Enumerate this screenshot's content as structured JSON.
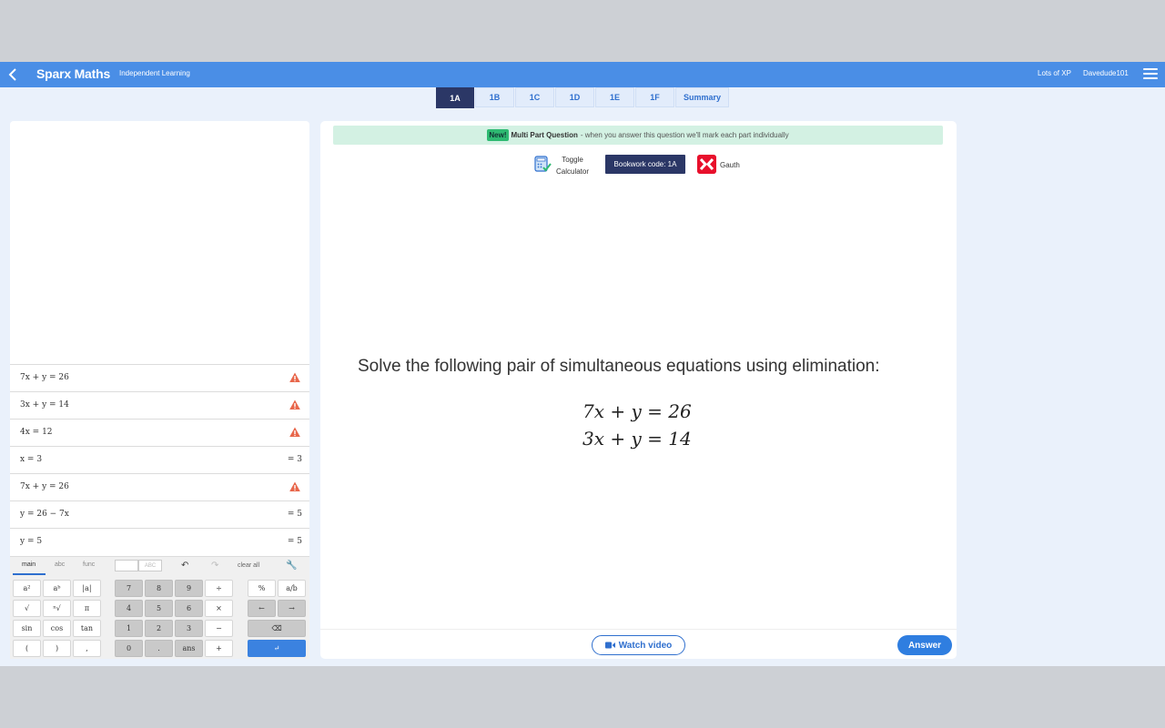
{
  "topbar": {
    "brand": "Sparx Maths",
    "subtitle": "Independent Learning",
    "xp": "Lots of XP",
    "user": "Davedude101"
  },
  "tabs": [
    "1A",
    "1B",
    "1C",
    "1D",
    "1E",
    "1F",
    "Summary"
  ],
  "calculator": {
    "history": [
      {
        "expr": "7x + y = 26",
        "result": "",
        "warning": true
      },
      {
        "expr": "3x + y = 14",
        "result": "",
        "warning": true
      },
      {
        "expr": "4x = 12",
        "result": "",
        "warning": true
      },
      {
        "expr": "x = 3",
        "result": "= 3",
        "warning": false
      },
      {
        "expr": "7x + y = 26",
        "result": "",
        "warning": true
      },
      {
        "expr": "y = 26 − 7x",
        "result": "= 5",
        "warning": false
      },
      {
        "expr": "y = 5",
        "result": "= 5",
        "warning": false
      }
    ],
    "keyboard_tabs": [
      "main",
      "abc",
      "func"
    ],
    "abc_placeholder": "ABC",
    "clear_all": "clear all",
    "keys": {
      "r1": [
        "a²",
        "aᵇ",
        "|a|",
        "7",
        "8",
        "9",
        "÷",
        "%",
        "a/b"
      ],
      "r2": [
        "√",
        "ⁿ√",
        "π",
        "4",
        "5",
        "6",
        "×",
        "←",
        "→"
      ],
      "r3": [
        "sin",
        "cos",
        "tan",
        "1",
        "2",
        "3",
        "−",
        "⌫"
      ],
      "r4": [
        "(",
        ")",
        ",",
        "0",
        ".",
        "ans",
        "+",
        "↵"
      ]
    }
  },
  "main": {
    "banner_badge": "New!",
    "banner_title": "Multi Part Question",
    "banner_text": "- when you answer this question we'll mark each part individually",
    "toggle_line1": "Toggle",
    "toggle_line2": "Calculator",
    "bookwork": "Bookwork code: 1A",
    "gauth": "Gauth",
    "question": "Solve the following pair of simultaneous equations using elimination:",
    "equations": [
      "7x + y = 26",
      "3x + y = 14"
    ],
    "watch_video": "Watch video",
    "answer": "Answer"
  },
  "colors": {
    "topbar": "#4a8ee6",
    "active_tab": "#2b3766",
    "primary": "#2f7ee0",
    "banner": "#d3f1e3",
    "new_badge": "#2fba72",
    "warning": "#e8664a",
    "gauth": "#e8102c"
  }
}
